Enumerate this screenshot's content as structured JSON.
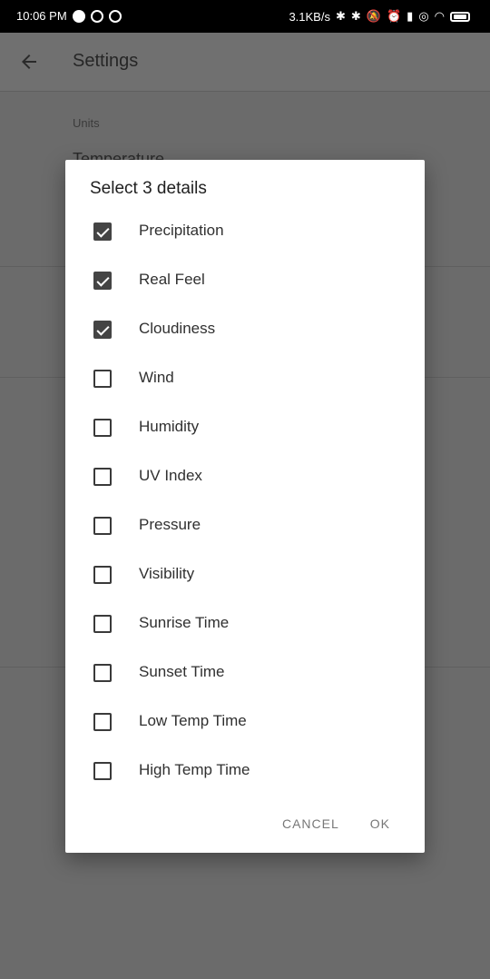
{
  "status_bar": {
    "time": "10:06 PM",
    "net_speed": "3.1KB/s",
    "battery_level": "60"
  },
  "app_bar": {
    "title": "Settings",
    "back_icon": "arrow-left-icon"
  },
  "background": {
    "section_units": "Units",
    "partially_hidden_text": "Temperature"
  },
  "dialog": {
    "title": "Select 3 details",
    "options": [
      {
        "label": "Precipitation",
        "checked": true
      },
      {
        "label": "Real Feel",
        "checked": true
      },
      {
        "label": "Cloudiness",
        "checked": true
      },
      {
        "label": "Wind",
        "checked": false
      },
      {
        "label": "Humidity",
        "checked": false
      },
      {
        "label": "UV Index",
        "checked": false
      },
      {
        "label": "Pressure",
        "checked": false
      },
      {
        "label": "Visibility",
        "checked": false
      },
      {
        "label": "Sunrise Time",
        "checked": false
      },
      {
        "label": "Sunset Time",
        "checked": false
      },
      {
        "label": "Low Temp Time",
        "checked": false
      },
      {
        "label": "High Temp Time",
        "checked": false
      }
    ],
    "cancel_label": "CANCEL",
    "ok_label": "OK"
  }
}
